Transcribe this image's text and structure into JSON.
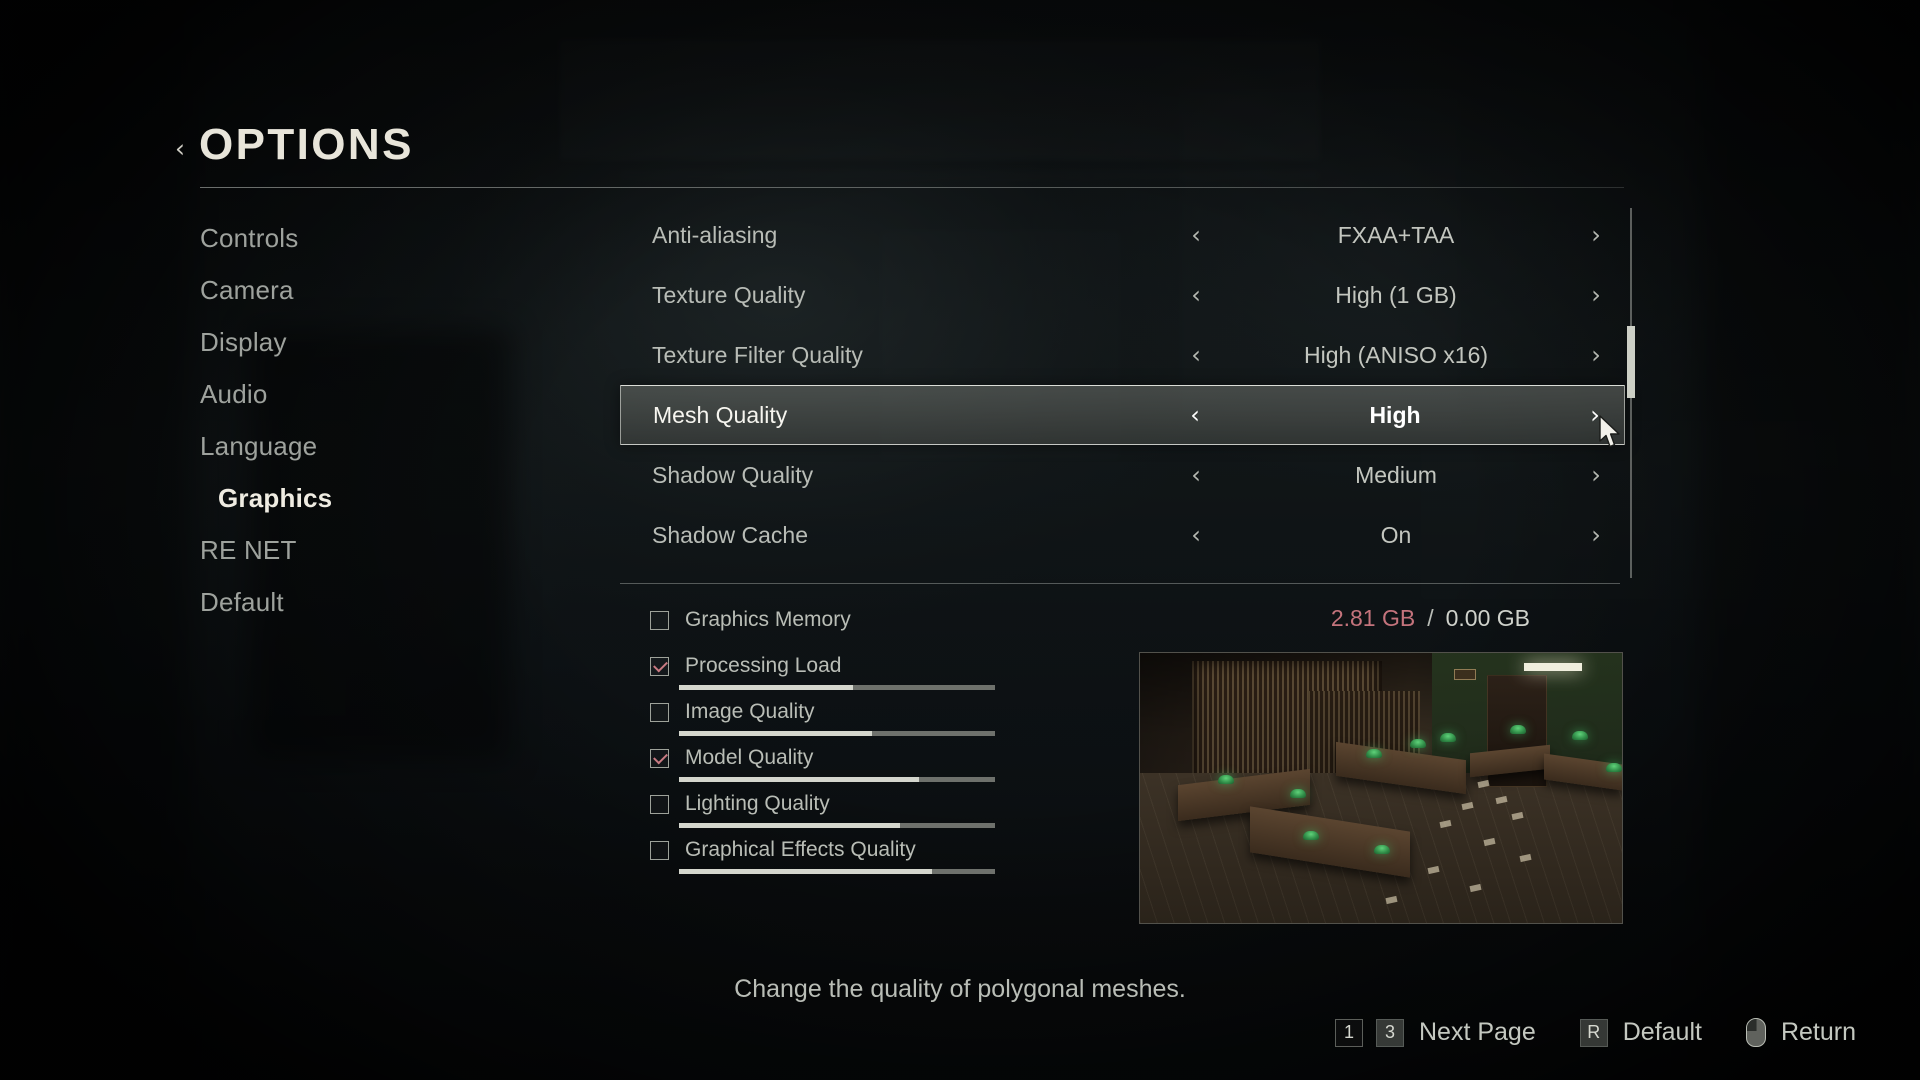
{
  "header": {
    "title": "OPTIONS",
    "back_icon": "chevron-left-icon"
  },
  "sidebar": {
    "items": [
      {
        "label": "Controls",
        "active": false
      },
      {
        "label": "Camera",
        "active": false
      },
      {
        "label": "Display",
        "active": false
      },
      {
        "label": "Audio",
        "active": false
      },
      {
        "label": "Language",
        "active": false
      },
      {
        "label": "Graphics",
        "active": true
      },
      {
        "label": "RE NET",
        "active": false
      },
      {
        "label": "Default",
        "active": false
      }
    ]
  },
  "options": {
    "left_arrow": "‹",
    "right_arrow": "›",
    "rows": [
      {
        "label": "Anti-aliasing",
        "value": "FXAA+TAA",
        "selected": false
      },
      {
        "label": "Texture Quality",
        "value": "High (1 GB)",
        "selected": false
      },
      {
        "label": "Texture Filter Quality",
        "value": "High (ANISO x16)",
        "selected": false
      },
      {
        "label": "Mesh Quality",
        "value": "High",
        "selected": true
      },
      {
        "label": "Shadow Quality",
        "value": "Medium",
        "selected": false
      },
      {
        "label": "Shadow Cache",
        "value": "On",
        "selected": false
      }
    ]
  },
  "graphics_memory": {
    "label": "Graphics Memory",
    "checked": false,
    "used": "2.81 GB",
    "separator": "/",
    "total": "0.00 GB",
    "used_color": "#c4737c"
  },
  "meters": [
    {
      "label": "Processing Load",
      "checked": true,
      "fill": 55
    },
    {
      "label": "Image Quality",
      "checked": false,
      "fill": 61
    },
    {
      "label": "Model Quality",
      "checked": true,
      "fill": 76
    },
    {
      "label": "Lighting Quality",
      "checked": false,
      "fill": 70
    },
    {
      "label": "Graphical Effects Quality",
      "checked": false,
      "fill": 80
    }
  ],
  "preview": {
    "alt": "library-room-preview"
  },
  "description": "Change the quality of polygonal meshes.",
  "footer": {
    "page_key_left": "1",
    "page_key_right": "3",
    "page_label": "Next Page",
    "default_key": "R",
    "default_label": "Default",
    "return_icon": "mouse-right-click-icon",
    "return_label": "Return"
  },
  "cursor": {
    "icon": "mouse-pointer-icon"
  }
}
